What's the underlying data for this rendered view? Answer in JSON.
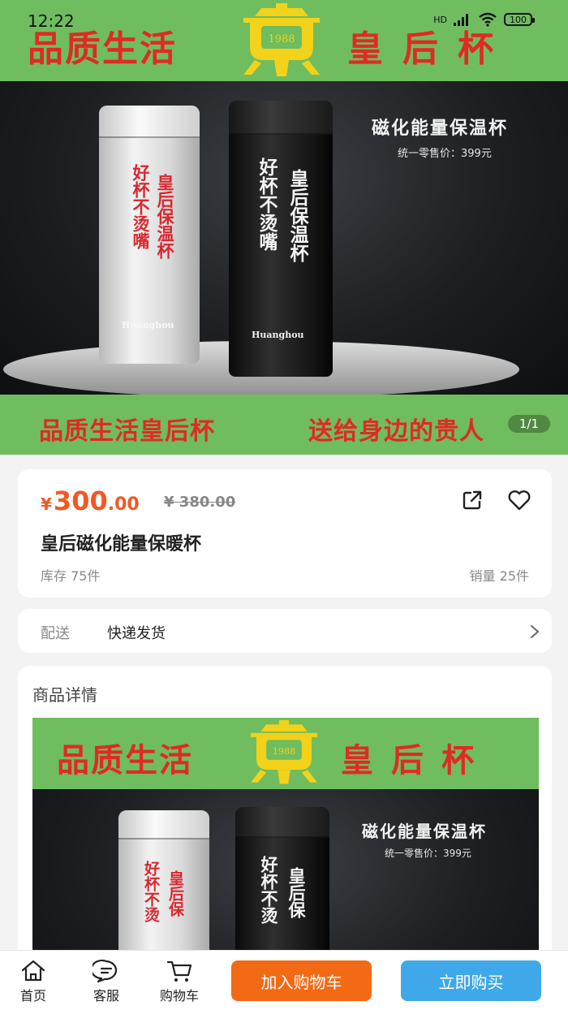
{
  "status_bar": {
    "time": "12:22",
    "network": "HD",
    "battery": "100"
  },
  "banner": {
    "top_left_slogan": "品质生活",
    "top_right_slogan": "皇后杯",
    "emblem_year": "1988",
    "product_title": "磁化能量保温杯",
    "retail_price": "统一零售价：399元",
    "silver_cup_text_1": "好杯不烫嘴",
    "silver_cup_text_2": "皇后保温杯",
    "black_cup_text_1": "好杯不烫嘴",
    "black_cup_text_2": "皇后保温杯",
    "cup_brand": "Huanghou",
    "bottom_slogan_left": "品质生活皇后杯",
    "bottom_slogan_right": "送给身边的贵人",
    "image_counter": "1/1"
  },
  "product": {
    "currency": "¥",
    "price_int": "300",
    "price_dec": ".00",
    "original_price": "¥ 380.00",
    "name": "皇后磁化能量保暖杯",
    "stock": "库存 75件",
    "sales": "销量 25件"
  },
  "delivery": {
    "label": "配送",
    "value": "快递发货"
  },
  "detail": {
    "title": "商品详情",
    "top_left_slogan": "品质生活",
    "top_right_slogan": "皇后杯",
    "emblem_year": "1988",
    "product_title": "磁化能量保温杯",
    "retail_price": "统一零售价：399元",
    "silver_cup_text_1": "好杯不烫",
    "silver_cup_text_2": "皇后保",
    "black_cup_text_1": "好杯不烫",
    "black_cup_text_2": "皇后保"
  },
  "bottom_bar": {
    "home": "首页",
    "service": "客服",
    "cart": "购物车",
    "add_to_cart": "加入购物车",
    "buy_now": "立即购买"
  },
  "colors": {
    "accent_price": "#ef5a24",
    "add_to_cart_button": "#f26a15",
    "buy_now_button": "#3fa8e8",
    "banner_green": "#6fbd5f",
    "slogan_red": "#e02a23"
  }
}
